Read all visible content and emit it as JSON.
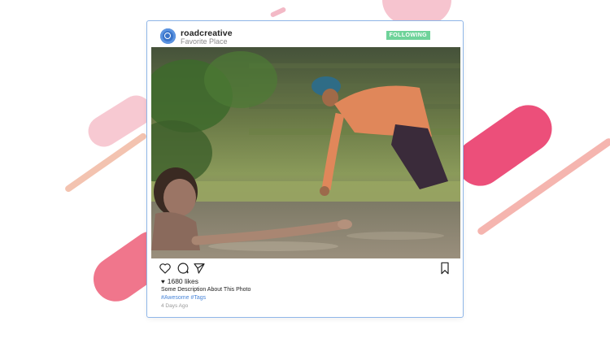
{
  "post": {
    "username": "roadcreative",
    "location": "Favorite Place",
    "follow_label": "FOLLOWING",
    "likes": "1680 likes",
    "description": "Some Description About This Photo",
    "tags": "#Awesome #Tags",
    "time": "4 Days Ago"
  },
  "icons": {
    "avatar": "camera-lens-icon",
    "like": "heart-icon",
    "comment": "comment-icon",
    "share": "send-icon",
    "save": "bookmark-icon"
  },
  "colors": {
    "card_border": "#8fb6e8",
    "follow_badge": "#6fd39a",
    "tags": "#4a86d8",
    "accent_stripe": "#ec4f7a"
  }
}
